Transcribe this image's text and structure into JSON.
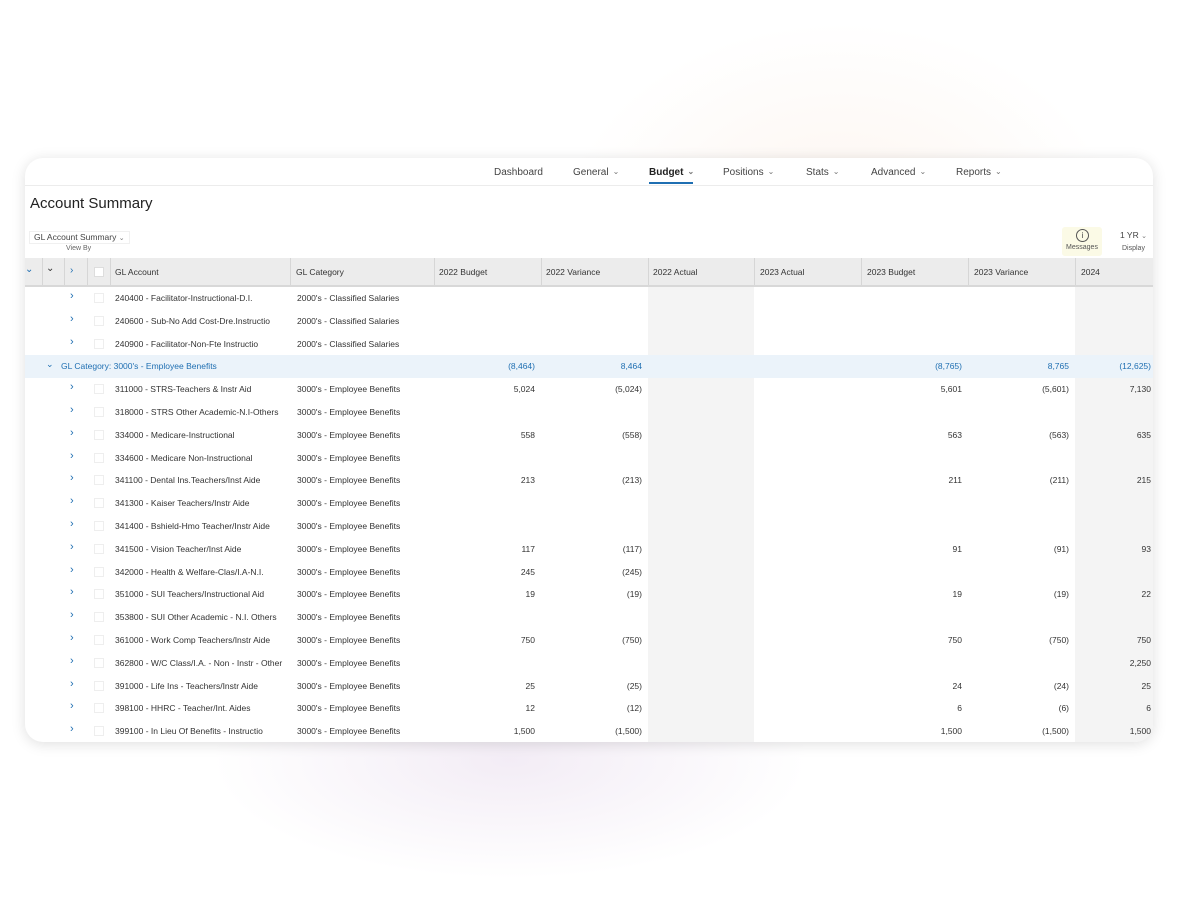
{
  "nav": {
    "items": [
      {
        "label": "Dashboard",
        "chevron": false
      },
      {
        "label": "General",
        "chevron": true
      },
      {
        "label": "Budget",
        "chevron": true,
        "active": true
      },
      {
        "label": "Positions",
        "chevron": true
      },
      {
        "label": "Stats",
        "chevron": true
      },
      {
        "label": "Advanced",
        "chevron": true
      },
      {
        "label": "Reports",
        "chevron": true
      }
    ]
  },
  "page": {
    "title": "Account Summary"
  },
  "toolbar": {
    "view_by_value": "GL Account Summary",
    "view_by_label": "View By",
    "messages_label": "Messages",
    "display_value": "1 YR",
    "display_label": "Display"
  },
  "icons": {
    "expand": "chevron-right-icon",
    "collapse": "chevron-down-icon",
    "info": "info-circle-icon"
  },
  "colors": {
    "accent": "#1f6fb2",
    "group_row": "#ebf3fa",
    "header": "#ececec"
  },
  "grid": {
    "columns": [
      "GL Account",
      "GL Category",
      "2022 Budget",
      "2022 Variance",
      "2022 Actual",
      "2023 Actual",
      "2023 Budget",
      "2023 Variance",
      "2024"
    ],
    "rows": [
      {
        "type": "item",
        "account": "240400 - Facilitator-Instructional-D.I.",
        "category": "2000's - Classified Salaries",
        "b22": "",
        "v22": "",
        "b23": "",
        "v23": "",
        "y24": ""
      },
      {
        "type": "item",
        "account": "240600 - Sub-No Add Cost-Dre.Instructio",
        "category": "2000's - Classified Salaries",
        "b22": "",
        "v22": "",
        "b23": "",
        "v23": "",
        "y24": ""
      },
      {
        "type": "item",
        "account": "240900 - Facilitator-Non-Fte Instructio",
        "category": "2000's - Classified Salaries",
        "b22": "",
        "v22": "",
        "b23": "",
        "v23": "",
        "y24": ""
      },
      {
        "type": "group",
        "label": "GL Category: 3000's - Employee Benefits",
        "b22": "(8,464)",
        "v22": "8,464",
        "b23": "(8,765)",
        "v23": "8,765",
        "y24": "(12,625)"
      },
      {
        "type": "item",
        "account": "311000 - STRS-Teachers & Instr Aid",
        "category": "3000's - Employee Benefits",
        "b22": "5,024",
        "v22": "(5,024)",
        "b23": "5,601",
        "v23": "(5,601)",
        "y24": "7,130"
      },
      {
        "type": "item",
        "account": "318000 - STRS Other Academic-N.I-Others",
        "category": "3000's - Employee Benefits",
        "b22": "",
        "v22": "",
        "b23": "",
        "v23": "",
        "y24": ""
      },
      {
        "type": "item",
        "account": "334000 - Medicare-Instructional",
        "category": "3000's - Employee Benefits",
        "b22": "558",
        "v22": "(558)",
        "b23": "563",
        "v23": "(563)",
        "y24": "635"
      },
      {
        "type": "item",
        "account": "334600 - Medicare Non-Instructional",
        "category": "3000's - Employee Benefits",
        "b22": "",
        "v22": "",
        "b23": "",
        "v23": "",
        "y24": ""
      },
      {
        "type": "item",
        "account": "341100 - Dental Ins.Teachers/Inst Aide",
        "category": "3000's - Employee Benefits",
        "b22": "213",
        "v22": "(213)",
        "b23": "211",
        "v23": "(211)",
        "y24": "215"
      },
      {
        "type": "item",
        "account": "341300 - Kaiser Teachers/Instr Aide",
        "category": "3000's - Employee Benefits",
        "b22": "",
        "v22": "",
        "b23": "",
        "v23": "",
        "y24": ""
      },
      {
        "type": "item",
        "account": "341400 - Bshield-Hmo Teacher/Instr Aide",
        "category": "3000's - Employee Benefits",
        "b22": "",
        "v22": "",
        "b23": "",
        "v23": "",
        "y24": ""
      },
      {
        "type": "item",
        "account": "341500 - Vision Teacher/Inst Aide",
        "category": "3000's - Employee Benefits",
        "b22": "117",
        "v22": "(117)",
        "b23": "91",
        "v23": "(91)",
        "y24": "93"
      },
      {
        "type": "item",
        "account": "342000 - Health & Welfare-Clas/I.A-N.I.",
        "category": "3000's - Employee Benefits",
        "b22": "245",
        "v22": "(245)",
        "b23": "",
        "v23": "",
        "y24": ""
      },
      {
        "type": "item",
        "account": "351000 - SUI Teachers/Instructional Aid",
        "category": "3000's - Employee Benefits",
        "b22": "19",
        "v22": "(19)",
        "b23": "19",
        "v23": "(19)",
        "y24": "22"
      },
      {
        "type": "item",
        "account": "353800 - SUI Other Academic - N.I. Others",
        "category": "3000's - Employee Benefits",
        "b22": "",
        "v22": "",
        "b23": "",
        "v23": "",
        "y24": ""
      },
      {
        "type": "item",
        "account": "361000 - Work Comp Teachers/Instr Aide",
        "category": "3000's - Employee Benefits",
        "b22": "750",
        "v22": "(750)",
        "b23": "750",
        "v23": "(750)",
        "y24": "750"
      },
      {
        "type": "item",
        "account": "362800 - W/C Class/I.A. - Non - Instr - Other",
        "category": "3000's - Employee Benefits",
        "b22": "",
        "v22": "",
        "b23": "",
        "v23": "",
        "y24": "2,250"
      },
      {
        "type": "item",
        "account": "391000 - Life Ins - Teachers/Instr Aide",
        "category": "3000's - Employee Benefits",
        "b22": "25",
        "v22": "(25)",
        "b23": "24",
        "v23": "(24)",
        "y24": "25"
      },
      {
        "type": "item",
        "account": "398100 - HHRC - Teacher/Int. Aides",
        "category": "3000's - Employee Benefits",
        "b22": "12",
        "v22": "(12)",
        "b23": "6",
        "v23": "(6)",
        "y24": "6"
      },
      {
        "type": "item",
        "account": "399100 - In Lieu Of Benefits - Instructio",
        "category": "3000's - Employee Benefits",
        "b22": "1,500",
        "v22": "(1,500)",
        "b23": "1,500",
        "v23": "(1,500)",
        "y24": "1,500"
      }
    ]
  }
}
